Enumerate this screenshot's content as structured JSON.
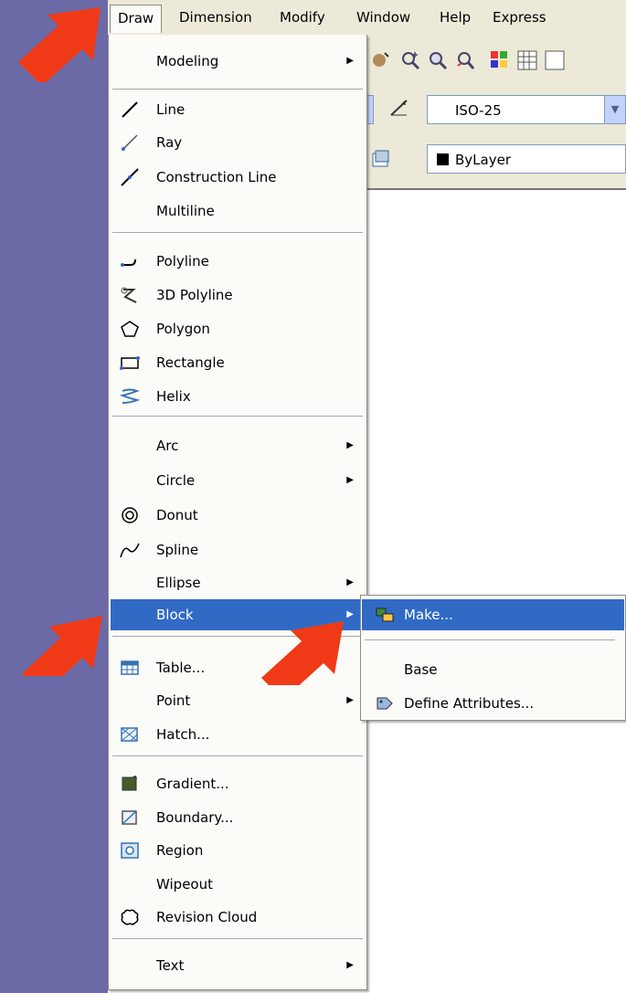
{
  "menubar": {
    "items": [
      "Draw",
      "Dimension",
      "Modify",
      "Window",
      "Help",
      "Express"
    ]
  },
  "toolbar": {
    "dim_style_combo": "ISO-25",
    "layer_combo": "ByLayer"
  },
  "draw_menu": {
    "items": [
      {
        "label": "Modeling",
        "submenu": true
      },
      {
        "label": "Line"
      },
      {
        "label": "Ray"
      },
      {
        "label": "Construction Line"
      },
      {
        "label": "Multiline"
      },
      {
        "label": "Polyline"
      },
      {
        "label": "3D Polyline"
      },
      {
        "label": "Polygon"
      },
      {
        "label": "Rectangle"
      },
      {
        "label": "Helix"
      },
      {
        "label": "Arc",
        "submenu": true
      },
      {
        "label": "Circle",
        "submenu": true
      },
      {
        "label": "Donut"
      },
      {
        "label": "Spline"
      },
      {
        "label": "Ellipse",
        "submenu": true
      },
      {
        "label": "Block",
        "submenu": true,
        "highlighted": true
      },
      {
        "label": "Table..."
      },
      {
        "label": "Point",
        "submenu": true
      },
      {
        "label": "Hatch..."
      },
      {
        "label": "Gradient..."
      },
      {
        "label": "Boundary..."
      },
      {
        "label": "Region"
      },
      {
        "label": "Wipeout"
      },
      {
        "label": "Revision Cloud"
      },
      {
        "label": "Text",
        "submenu": true
      }
    ]
  },
  "block_submenu": {
    "items": [
      {
        "label": "Make...",
        "highlighted": true
      },
      {
        "label": "Base"
      },
      {
        "label": "Define Attributes..."
      }
    ]
  },
  "colors": {
    "background": "#6b6aa6",
    "menu_highlight": "#316ac5",
    "arrow": "#f03a17",
    "menu_bg": "#fbfbf8"
  }
}
